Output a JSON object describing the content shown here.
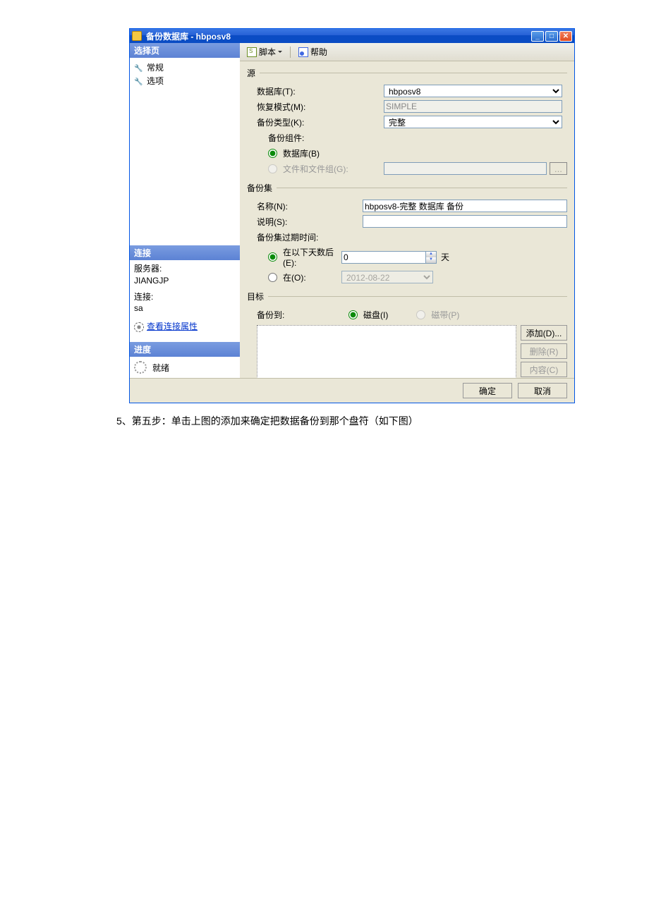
{
  "titlebar": {
    "title": "备份数据库 - hbposv8"
  },
  "sidebar": {
    "select_page_header": "选择页",
    "items": [
      {
        "label": "常规"
      },
      {
        "label": "选项"
      }
    ],
    "connection_header": "连接",
    "server_label": "服务器:",
    "server_value": "JIANGJP",
    "conn_label": "连接:",
    "conn_value": "sa",
    "view_props": "查看连接属性",
    "progress_header": "进度",
    "ready": "就绪"
  },
  "toolbar": {
    "script": "脚本",
    "help": "帮助"
  },
  "source": {
    "group": "源",
    "database_label": "数据库(T):",
    "database_value": "hbposv8",
    "recovery_label": "恢复模式(M):",
    "recovery_value": "SIMPLE",
    "backup_type_label": "备份类型(K):",
    "backup_type_value": "完整",
    "component_label": "备份组件:",
    "radio_db": "数据库(B)",
    "radio_files": "文件和文件组(G):",
    "browse": "..."
  },
  "backupset": {
    "group": "备份集",
    "name_label": "名称(N):",
    "name_value": "hbposv8-完整 数据库 备份",
    "desc_label": "说明(S):",
    "desc_value": "",
    "expire_label": "备份集过期时间:",
    "after_label": "在以下天数后(E):",
    "after_value": "0",
    "after_unit": "天",
    "on_label": "在(O):",
    "on_value": "2012-08-22"
  },
  "destination": {
    "group": "目标",
    "backup_to_label": "备份到:",
    "radio_disk": "磁盘(I)",
    "radio_tape": "磁带(P)",
    "add": "添加(D)...",
    "remove": "删除(R)",
    "contents": "内容(C)"
  },
  "footer": {
    "ok": "确定",
    "cancel": "取消"
  },
  "caption": "5、第五步：单击上图的添加来确定把数据备份到那个盘符（如下图）"
}
